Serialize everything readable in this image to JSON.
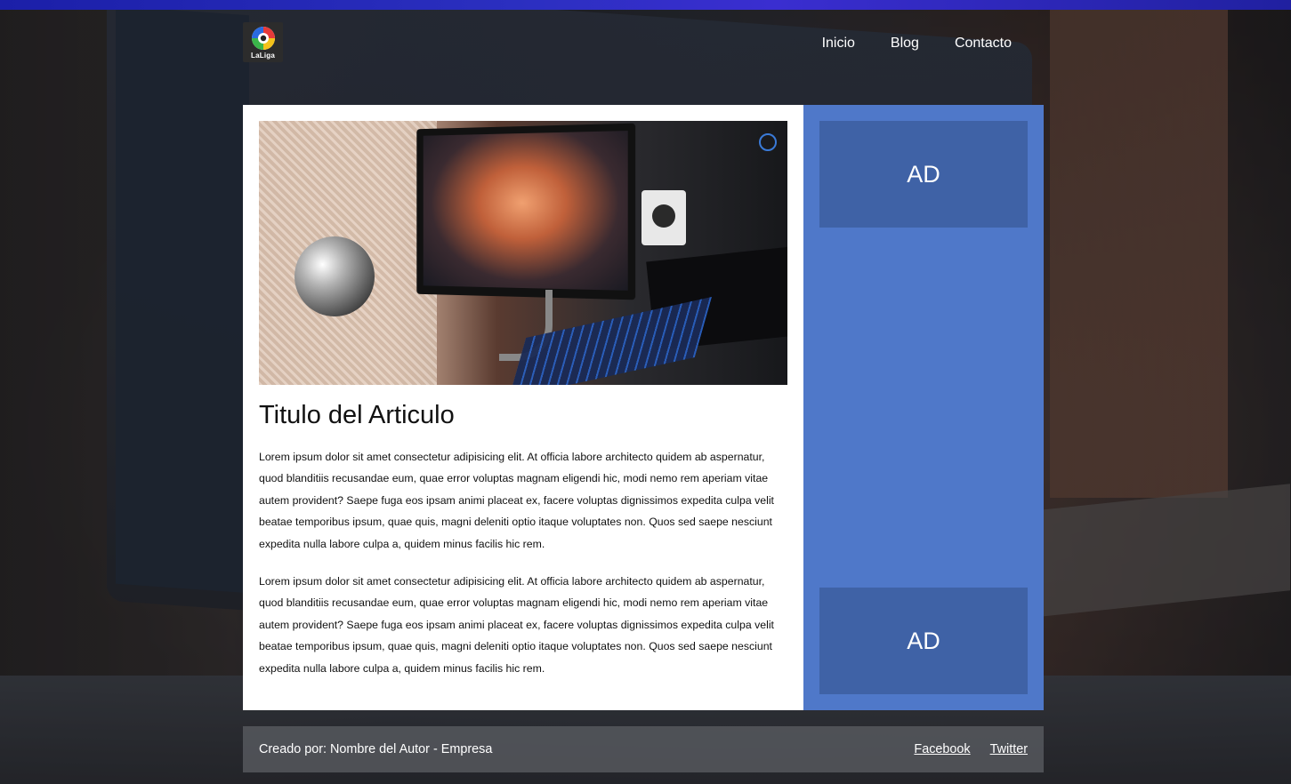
{
  "header": {
    "logo_text": "LaLiga",
    "nav": [
      {
        "label": "Inicio"
      },
      {
        "label": "Blog"
      },
      {
        "label": "Contacto"
      }
    ]
  },
  "article": {
    "title": "Titulo del Articulo",
    "paragraphs": [
      "Lorem ipsum dolor sit amet consectetur adipisicing elit. At officia labore architecto quidem ab aspernatur, quod blanditiis recusandae eum, quae error voluptas magnam eligendi hic, modi nemo rem aperiam vitae autem provident? Saepe fuga eos ipsam animi placeat ex, facere voluptas dignissimos expedita culpa velit beatae temporibus ipsum, quae quis, magni deleniti optio itaque voluptates non. Quos sed saepe nesciunt expedita nulla labore culpa a, quidem minus facilis hic rem.",
      "Lorem ipsum dolor sit amet consectetur adipisicing elit. At officia labore architecto quidem ab aspernatur, quod blanditiis recusandae eum, quae error voluptas magnam eligendi hic, modi nemo rem aperiam vitae autem provident? Saepe fuga eos ipsam animi placeat ex, facere voluptas dignissimos expedita culpa velit beatae temporibus ipsum, quae quis, magni deleniti optio itaque voluptates non. Quos sed saepe nesciunt expedita nulla labore culpa a, quidem minus facilis hic rem."
    ]
  },
  "sidebar": {
    "ads": [
      {
        "label": "AD"
      },
      {
        "label": "AD"
      }
    ]
  },
  "footer": {
    "credit": "Creado por: Nombre del Autor - Empresa",
    "social": [
      {
        "label": "Facebook"
      },
      {
        "label": "Twitter"
      }
    ]
  },
  "colors": {
    "sidebar_bg": "#4f78c9",
    "ad_bg": "#3f62a6",
    "top_strip": "#2b2fc0"
  }
}
